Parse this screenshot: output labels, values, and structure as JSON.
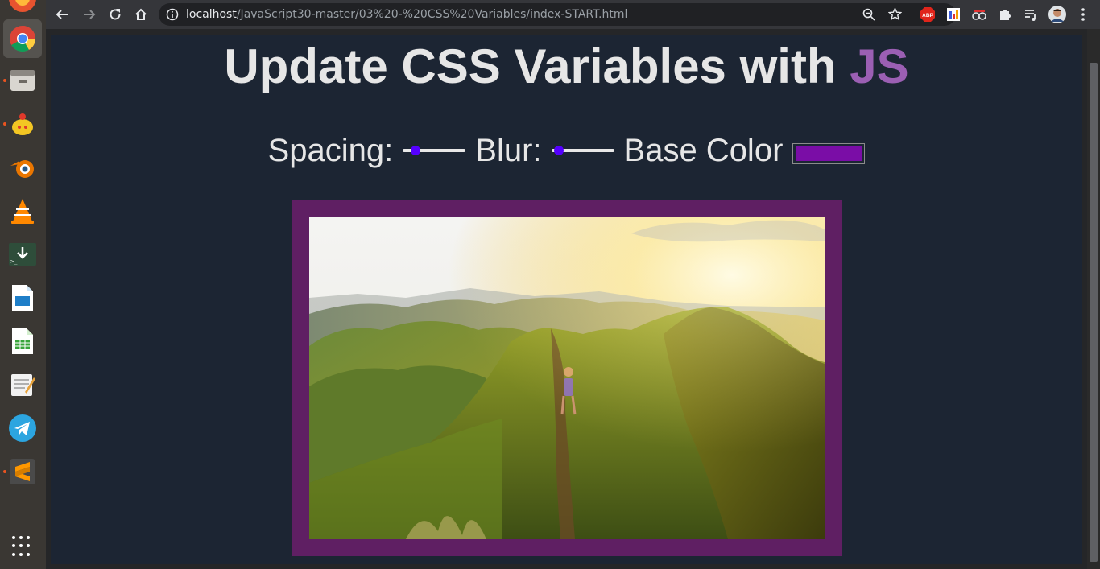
{
  "browser": {
    "url_host": "localhost",
    "url_path": "/JavaScript30-master/03%20-%20CSS%20Variables/index-START.html",
    "extensions": [
      "abp-icon",
      "color-extension-icon",
      "spy-extension-icon",
      "puzzle-icon",
      "media-queue-icon"
    ],
    "abp_label": "ABP"
  },
  "page": {
    "title_main": "Update CSS Variables with ",
    "title_accent": "JS",
    "spacing_label": "Spacing:",
    "blur_label": "Blur:",
    "base_color_label": "Base Color",
    "spacing_value": 0.15,
    "blur_value": 0.05,
    "base_color": "#7a0da6",
    "frame_color": "#5f1f63",
    "background_color": "#1c2533",
    "accent_color": "#9b5fb3"
  },
  "dock": {
    "apps": [
      "firefox-icon",
      "chrome-icon",
      "files-icon",
      "tea-icon",
      "blender-icon",
      "vlc-icon",
      "terminal-download-icon",
      "writer-icon",
      "calc-icon",
      "text-editor-icon",
      "telegram-icon",
      "sublime-icon"
    ]
  }
}
